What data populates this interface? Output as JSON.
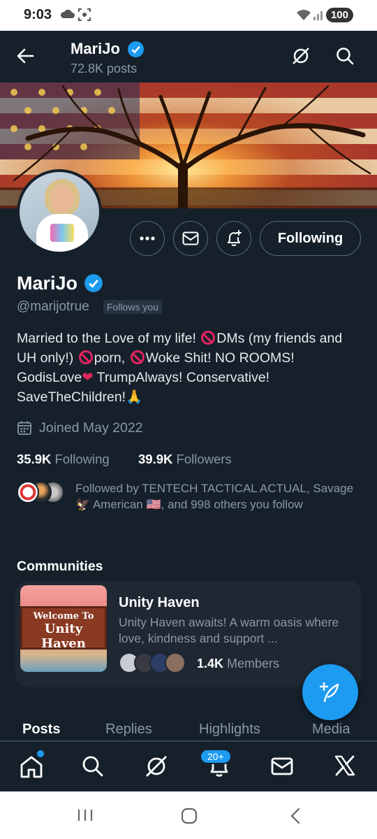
{
  "status_bar": {
    "time": "9:03",
    "battery": "100"
  },
  "header": {
    "name": "MariJo",
    "posts": "72.8K posts"
  },
  "profile": {
    "name": "MariJo",
    "handle": "@marijotrue",
    "follows_you": "Follows you",
    "bio": {
      "p1": "Married to the Love of my life! ",
      "p2": "DMs (my friends and UH only!) ",
      "p3": "porn, ",
      "p4": "Woke Shit! NO ROOMS! GodisLove",
      "p5": " TrumpAlways! Conservative! SaveTheChildren!",
      "heart": "❤",
      "pray": "🙏"
    },
    "joined": "Joined May 2022",
    "following_count": "35.9K",
    "following_label": "Following",
    "followers_count": "39.9K",
    "followers_label": "Followers",
    "followed_by": "Followed by TENTECH TACTICAL ACTUAL, Savage 🦅 American 🇺🇸, and 998 others you follow",
    "follow_button": "Following"
  },
  "communities": {
    "title": "Communities",
    "items": [
      {
        "name": "Unity Haven",
        "description": "Unity Haven awaits! A warm oasis where love, kindness and support ...",
        "members_count": "1.4K",
        "members_label": "Members",
        "image_text_1": "Welcome  To",
        "image_text_2": "Unity Haven"
      }
    ]
  },
  "tabs": [
    "Posts",
    "Replies",
    "Highlights",
    "Media"
  ],
  "bottom_nav": {
    "notifications_badge": "20+"
  },
  "colors": {
    "background": "#15202b",
    "accent": "#1d9bf0",
    "text_secondary": "#8b98a5"
  },
  "icons": [
    "back-arrow-icon",
    "grok-icon",
    "search-icon",
    "more-icon",
    "mail-icon",
    "notify-bell-icon",
    "calendar-icon",
    "compose-icon",
    "home-icon",
    "bell-icon",
    "x-logo-icon"
  ]
}
